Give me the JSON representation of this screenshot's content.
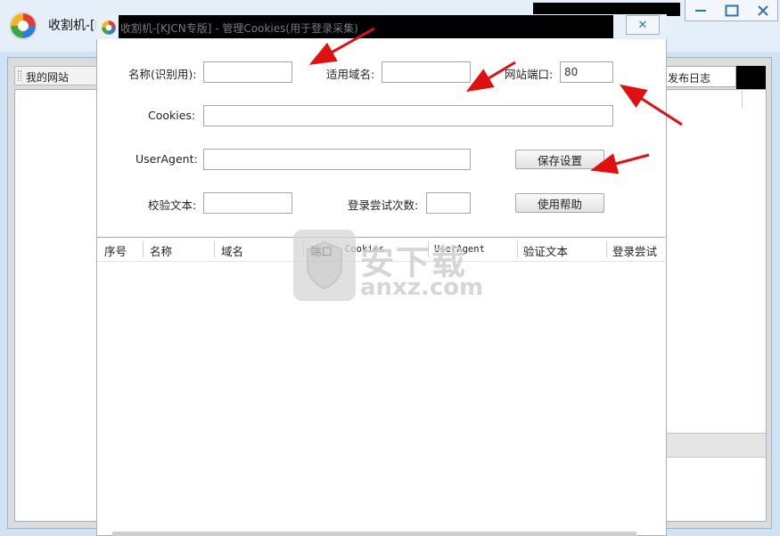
{
  "main_window": {
    "title": "收割机-[K",
    "window_controls": {
      "minimize_icon": "minimize-icon",
      "maximize_icon": "maximize-icon",
      "close_icon": "close-icon"
    },
    "sidebar_title": "我的网站",
    "tab_publish_log": "发布日志"
  },
  "dialog": {
    "title": "收割机-[KJCN专版] - 管理Cookies(用于登录采集)",
    "close_glyph": "✕",
    "fields": {
      "name_label": "名称(识别用):",
      "name_value": "",
      "domain_label": "适用域名:",
      "domain_value": "",
      "port_label": "网站端口:",
      "port_value": "80",
      "cookies_label": "Cookies:",
      "cookies_value": "",
      "useragent_label": "UserAgent:",
      "useragent_value": "",
      "verify_label": "校验文本:",
      "verify_value": "",
      "attempts_label": "登录尝试次数:",
      "attempts_value": ""
    },
    "buttons": {
      "save": "保存设置",
      "help": "使用帮助"
    },
    "grid": {
      "columns": [
        "序号",
        "名称",
        "域名",
        "端口",
        "Cookies",
        "UserAgent",
        "验证文本",
        "登录尝试"
      ],
      "rows": []
    }
  },
  "watermark": {
    "cn": "安下载",
    "en": "anxz.com"
  },
  "colors": {
    "arrow": "#e01010",
    "title_black": "#000000",
    "accent_blue": "#2f72b6"
  }
}
